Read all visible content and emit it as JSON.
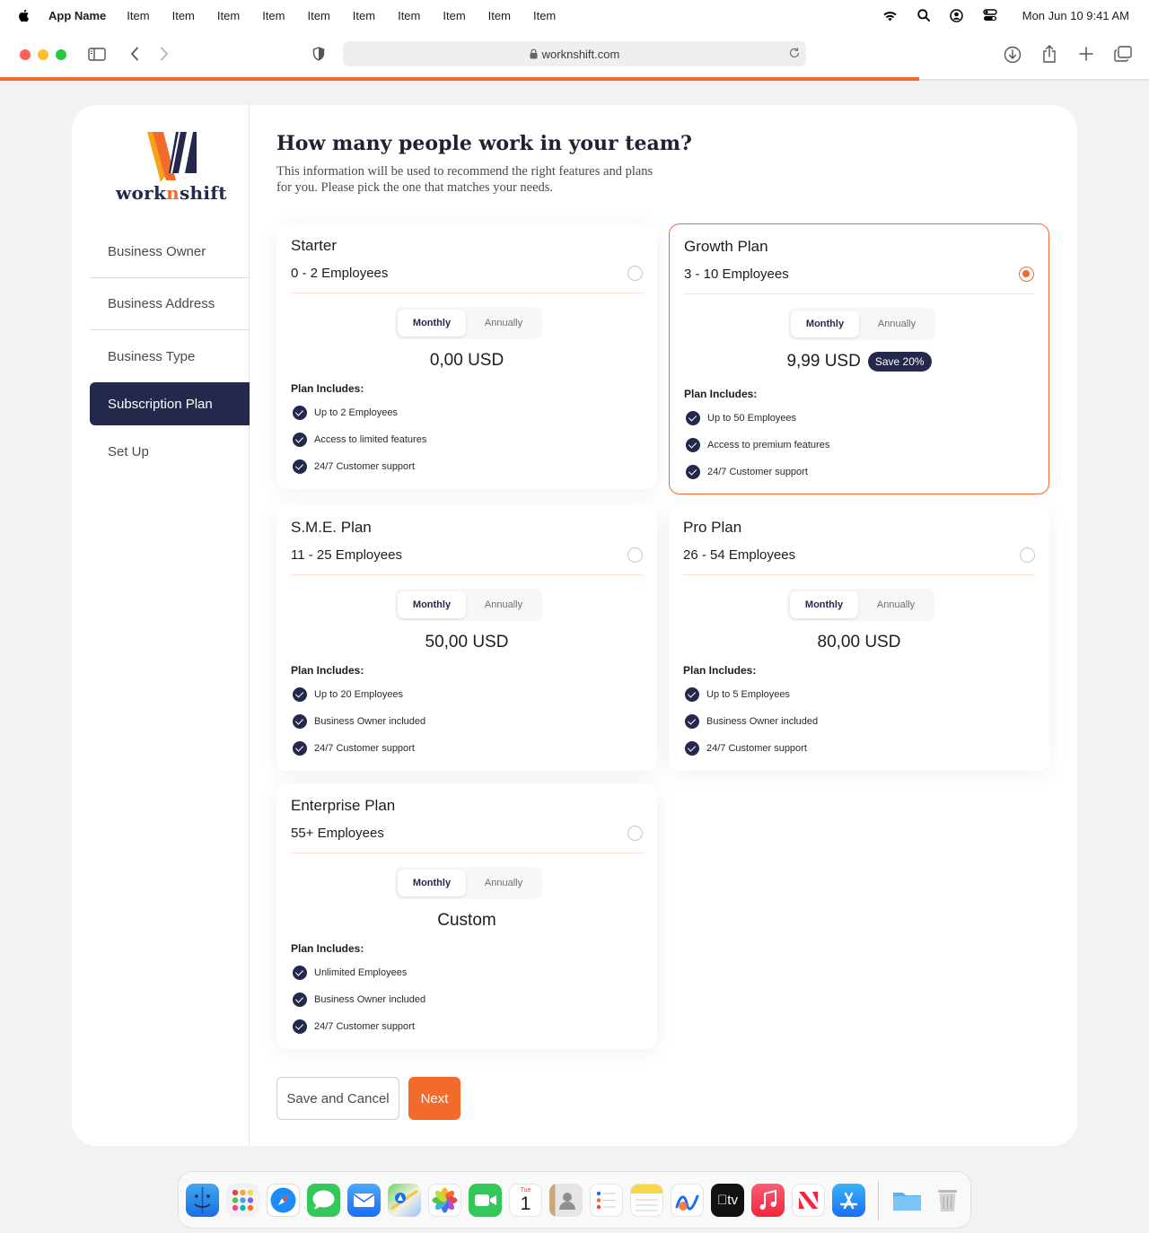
{
  "menubar": {
    "app_name": "App Name",
    "items": [
      "Item",
      "Item",
      "Item",
      "Item",
      "Item",
      "Item",
      "Item",
      "Item",
      "Item",
      "Item"
    ],
    "clock": "Mon Jun 10  9:41 AM"
  },
  "browser": {
    "url": "worknshift.com",
    "load_progress": 0.8
  },
  "brand": {
    "logo_text_a": "work",
    "logo_text_n": "n",
    "logo_text_b": "shift",
    "accent": "#f26b2d",
    "navy": "#25284d"
  },
  "sidebar": {
    "items": [
      {
        "label": "Business Owner"
      },
      {
        "label": "Business Address"
      },
      {
        "label": "Business Type"
      },
      {
        "label": "Subscription Plan",
        "active": true
      },
      {
        "label": "Set Up"
      }
    ]
  },
  "page": {
    "title": "How many people work in your team?",
    "subtitle": "This information will be used to recommend the right features and plans for you. Please pick the one that matches your needs."
  },
  "plans": [
    {
      "name": "Starter",
      "range": "0 - 2 Employees",
      "selected": false,
      "toggle_monthly": "Monthly",
      "toggle_annually": "Annually",
      "price": "0,00 USD",
      "badge": "",
      "includes_title": "Plan Includes:",
      "features": [
        "Up to 2 Employees",
        "Access to limited features",
        "24/7 Customer support"
      ]
    },
    {
      "name": "Growth Plan",
      "range": "3 - 10 Employees",
      "selected": true,
      "toggle_monthly": "Monthly",
      "toggle_annually": "Annually",
      "price": "9,99 USD",
      "badge": "Save 20%",
      "includes_title": "Plan Includes:",
      "features": [
        "Up to 50 Employees",
        "Access to premium features",
        "24/7 Customer support"
      ]
    },
    {
      "name": "S.M.E. Plan",
      "range": "11 - 25 Employees",
      "selected": false,
      "toggle_monthly": "Monthly",
      "toggle_annually": "Annually",
      "price": "50,00 USD",
      "badge": "",
      "includes_title": "Plan Includes:",
      "features": [
        "Up to 20 Employees",
        "Business Owner included",
        "24/7 Customer support"
      ]
    },
    {
      "name": "Pro Plan",
      "range": "26 - 54 Employees",
      "selected": false,
      "toggle_monthly": "Monthly",
      "toggle_annually": "Annually",
      "price": "80,00 USD",
      "badge": "",
      "includes_title": "Plan Includes:",
      "features": [
        "Up to 5 Employees",
        "Business Owner included",
        "24/7 Customer support"
      ]
    },
    {
      "name": "Enterprise Plan",
      "range": "55+ Employees",
      "selected": false,
      "toggle_monthly": "Monthly",
      "toggle_annually": "Annually",
      "price": "Custom",
      "badge": "",
      "includes_title": "Plan Includes:",
      "features": [
        "Unlimited Employees",
        "Business Owner included",
        "24/7 Customer support"
      ]
    }
  ],
  "actions": {
    "cancel_label": "Save and Cancel",
    "next_label": "Next"
  },
  "dock": {
    "apps": [
      "finder-icon",
      "launchpad-icon",
      "safari-icon",
      "messages-icon",
      "mail-icon",
      "maps-icon",
      "photos-icon",
      "facetime-icon",
      "calendar-icon",
      "contacts-icon",
      "reminders-icon",
      "notes-icon",
      "freeform-icon",
      "tv-icon",
      "music-icon",
      "news-icon",
      "app-store-icon",
      "folder-icon",
      "trash-icon"
    ],
    "calendar_month": "Tue",
    "calendar_day": "1",
    "tv_label": "tv"
  }
}
